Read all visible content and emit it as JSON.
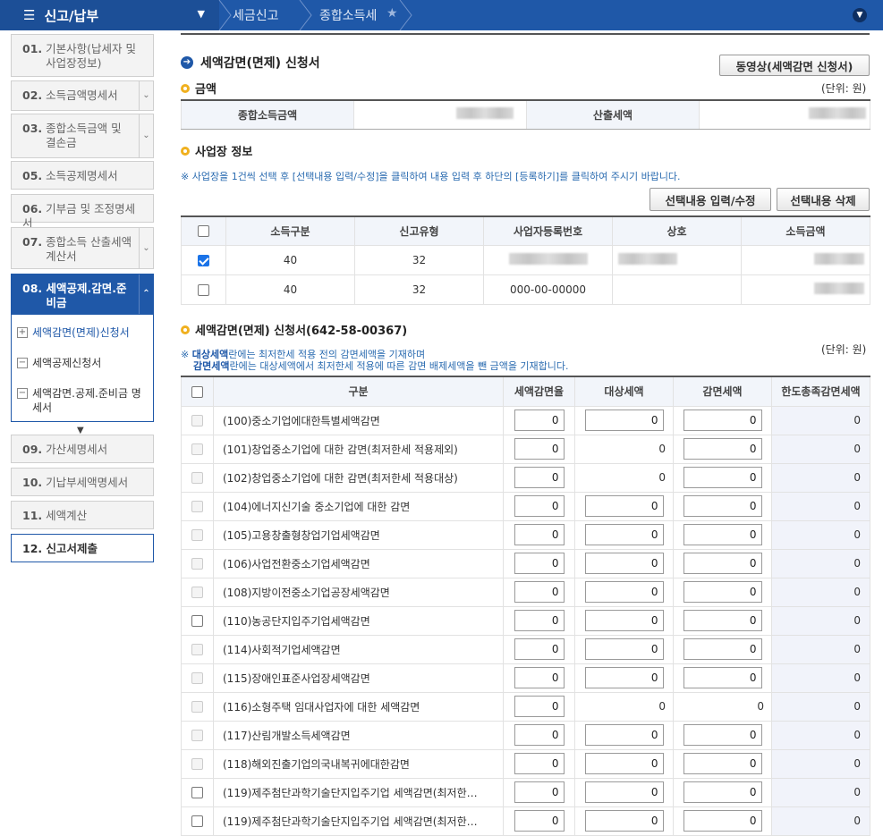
{
  "topbar": {
    "menu_label": "신고/납부",
    "breadcrumb": [
      "세금신고",
      "종합소득세"
    ]
  },
  "sidebar": {
    "steps_top": [
      {
        "num": "01.",
        "label": "기본사항(납세자 및 사업장정보)"
      },
      {
        "num": "02.",
        "label": "소득금액명세서"
      },
      {
        "num": "03.",
        "label": "종합소득금액 및 결손금"
      },
      {
        "num": "05.",
        "label": "소득공제명세서"
      },
      {
        "num": "06.",
        "label": "기부금 및 조정명세서"
      },
      {
        "num": "07.",
        "label": "종합소득 산출세액계산서"
      },
      {
        "num": "08.",
        "label": "세액공제.감면.준비금"
      }
    ],
    "sub_items": [
      "세액감면(면제)신청서",
      "세액공제신청서",
      "세액감면.공제.준비금 명세서"
    ],
    "steps_bottom": [
      {
        "num": "09.",
        "label": "가산세명세서"
      },
      {
        "num": "10.",
        "label": "기납부세액명세서"
      },
      {
        "num": "11.",
        "label": "세액계산"
      },
      {
        "num": "12.",
        "label": "신고서제출"
      }
    ]
  },
  "main": {
    "title": "세액감면(면제) 신청서",
    "video_button": "동영상(세액감면 신청서)",
    "amount_section": {
      "title": "금액",
      "unit": "(단위: 원)",
      "label_income": "종합소득금액",
      "label_tax": "산출세액"
    },
    "business_section": {
      "title": "사업장 정보",
      "note": "※ 사업장을 1건씩 선택 후 [선택내용 입력/수정]을 클릭하여 내용 입력 후 하단의 [등록하기]를 클릭하여 주시기 바랍니다.",
      "btn_edit": "선택내용 입력/수정",
      "btn_delete": "선택내용 삭제",
      "columns": [
        "소득구분",
        "신고유형",
        "사업자등록번호",
        "상호",
        "소득금액"
      ],
      "rows": [
        {
          "checked": true,
          "income_type": "40",
          "report_type": "32",
          "reg_no": "",
          "name": "",
          "amount": ""
        },
        {
          "checked": false,
          "income_type": "40",
          "report_type": "32",
          "reg_no": "000-00-00000",
          "name": "",
          "amount": ""
        }
      ]
    },
    "reduction_section": {
      "title": "세액감면(면제) 신청서(642-58-00367)",
      "unit": "(단위: 원)",
      "note1_bold": "대상세액",
      "note1_rest": "란에는 최저한세 적용 전의 감면세액을 기재하며",
      "note2_bold": "감면세액",
      "note2_rest": "란에는 대상세액에서 최저한세 적용에 따른 감면 배제세액을 뺀 금액을 기재합니다.",
      "note_prefix": "※",
      "columns": [
        "구분",
        "세액감면율",
        "대상세액",
        "감면세액",
        "한도총족감면세액"
      ],
      "rows": [
        {
          "label": "(100)중소기업에대한특별세액감면",
          "rate": "0",
          "target": "0",
          "reduced": "0",
          "limit": "0",
          "enabled": false,
          "target_input": true,
          "reduced_input": true
        },
        {
          "label": "(101)창업중소기업에 대한 감면(최저한세 적용제외)",
          "rate": "0",
          "target": "0",
          "reduced": "0",
          "limit": "0",
          "enabled": false,
          "target_input": false,
          "reduced_input": true
        },
        {
          "label": "(102)창업중소기업에 대한 감면(최저한세 적용대상)",
          "rate": "0",
          "target": "0",
          "reduced": "0",
          "limit": "0",
          "enabled": false,
          "target_input": false,
          "reduced_input": true
        },
        {
          "label": "(104)에너지신기술 중소기업에 대한 감면",
          "rate": "0",
          "target": "0",
          "reduced": "0",
          "limit": "0",
          "enabled": false,
          "target_input": true,
          "reduced_input": true
        },
        {
          "label": "(105)고용창출형창업기업세액감면",
          "rate": "0",
          "target": "0",
          "reduced": "0",
          "limit": "0",
          "enabled": false,
          "target_input": true,
          "reduced_input": true
        },
        {
          "label": "(106)사업전환중소기업세액감면",
          "rate": "0",
          "target": "0",
          "reduced": "0",
          "limit": "0",
          "enabled": false,
          "target_input": true,
          "reduced_input": true
        },
        {
          "label": "(108)지방이전중소기업공장세액감면",
          "rate": "0",
          "target": "0",
          "reduced": "0",
          "limit": "0",
          "enabled": false,
          "target_input": true,
          "reduced_input": true
        },
        {
          "label": "(110)농공단지입주기업세액감면",
          "rate": "0",
          "target": "0",
          "reduced": "0",
          "limit": "0",
          "enabled": true,
          "target_input": true,
          "reduced_input": true
        },
        {
          "label": "(114)사회적기업세액감면",
          "rate": "0",
          "target": "0",
          "reduced": "0",
          "limit": "0",
          "enabled": false,
          "target_input": true,
          "reduced_input": true
        },
        {
          "label": "(115)장애인표준사업장세액감면",
          "rate": "0",
          "target": "0",
          "reduced": "0",
          "limit": "0",
          "enabled": false,
          "target_input": true,
          "reduced_input": true
        },
        {
          "label": "(116)소형주택 임대사업자에 대한 세액감면",
          "rate": "0",
          "target": "0",
          "reduced": "0",
          "limit": "0",
          "enabled": false,
          "target_input": false,
          "reduced_input": false
        },
        {
          "label": "(117)산림개발소득세액감면",
          "rate": "0",
          "target": "0",
          "reduced": "0",
          "limit": "0",
          "enabled": false,
          "target_input": true,
          "reduced_input": true
        },
        {
          "label": "(118)해외진출기업의국내복귀에대한감면",
          "rate": "0",
          "target": "0",
          "reduced": "0",
          "limit": "0",
          "enabled": false,
          "target_input": true,
          "reduced_input": true
        },
        {
          "label": "(119)제주첨단과학기술단지입주기업 세액감면(최저한…",
          "rate": "0",
          "target": "0",
          "reduced": "0",
          "limit": "0",
          "enabled": true,
          "target_input": true,
          "reduced_input": true
        },
        {
          "label": "(119)제주첨단과학기술단지입주기업 세액감면(최저한…",
          "rate": "0",
          "target": "0",
          "reduced": "0",
          "limit": "0",
          "enabled": true,
          "target_input": true,
          "reduced_input": true
        }
      ]
    }
  },
  "colors": {
    "primary": "#1f58a8",
    "accent_dot": "#f0b01e",
    "note_text": "#2a6bb0"
  }
}
